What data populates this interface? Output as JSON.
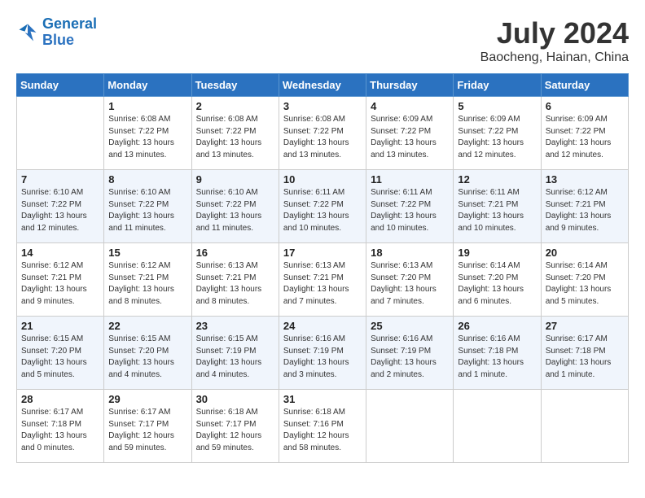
{
  "header": {
    "logo_line1": "General",
    "logo_line2": "Blue",
    "month": "July 2024",
    "location": "Baocheng, Hainan, China"
  },
  "days_of_week": [
    "Sunday",
    "Monday",
    "Tuesday",
    "Wednesday",
    "Thursday",
    "Friday",
    "Saturday"
  ],
  "weeks": [
    [
      {
        "day": "",
        "info": ""
      },
      {
        "day": "1",
        "info": "Sunrise: 6:08 AM\nSunset: 7:22 PM\nDaylight: 13 hours\nand 13 minutes."
      },
      {
        "day": "2",
        "info": "Sunrise: 6:08 AM\nSunset: 7:22 PM\nDaylight: 13 hours\nand 13 minutes."
      },
      {
        "day": "3",
        "info": "Sunrise: 6:08 AM\nSunset: 7:22 PM\nDaylight: 13 hours\nand 13 minutes."
      },
      {
        "day": "4",
        "info": "Sunrise: 6:09 AM\nSunset: 7:22 PM\nDaylight: 13 hours\nand 13 minutes."
      },
      {
        "day": "5",
        "info": "Sunrise: 6:09 AM\nSunset: 7:22 PM\nDaylight: 13 hours\nand 12 minutes."
      },
      {
        "day": "6",
        "info": "Sunrise: 6:09 AM\nSunset: 7:22 PM\nDaylight: 13 hours\nand 12 minutes."
      }
    ],
    [
      {
        "day": "7",
        "info": "Sunrise: 6:10 AM\nSunset: 7:22 PM\nDaylight: 13 hours\nand 12 minutes."
      },
      {
        "day": "8",
        "info": "Sunrise: 6:10 AM\nSunset: 7:22 PM\nDaylight: 13 hours\nand 11 minutes."
      },
      {
        "day": "9",
        "info": "Sunrise: 6:10 AM\nSunset: 7:22 PM\nDaylight: 13 hours\nand 11 minutes."
      },
      {
        "day": "10",
        "info": "Sunrise: 6:11 AM\nSunset: 7:22 PM\nDaylight: 13 hours\nand 10 minutes."
      },
      {
        "day": "11",
        "info": "Sunrise: 6:11 AM\nSunset: 7:22 PM\nDaylight: 13 hours\nand 10 minutes."
      },
      {
        "day": "12",
        "info": "Sunrise: 6:11 AM\nSunset: 7:21 PM\nDaylight: 13 hours\nand 10 minutes."
      },
      {
        "day": "13",
        "info": "Sunrise: 6:12 AM\nSunset: 7:21 PM\nDaylight: 13 hours\nand 9 minutes."
      }
    ],
    [
      {
        "day": "14",
        "info": "Sunrise: 6:12 AM\nSunset: 7:21 PM\nDaylight: 13 hours\nand 9 minutes."
      },
      {
        "day": "15",
        "info": "Sunrise: 6:12 AM\nSunset: 7:21 PM\nDaylight: 13 hours\nand 8 minutes."
      },
      {
        "day": "16",
        "info": "Sunrise: 6:13 AM\nSunset: 7:21 PM\nDaylight: 13 hours\nand 8 minutes."
      },
      {
        "day": "17",
        "info": "Sunrise: 6:13 AM\nSunset: 7:21 PM\nDaylight: 13 hours\nand 7 minutes."
      },
      {
        "day": "18",
        "info": "Sunrise: 6:13 AM\nSunset: 7:20 PM\nDaylight: 13 hours\nand 7 minutes."
      },
      {
        "day": "19",
        "info": "Sunrise: 6:14 AM\nSunset: 7:20 PM\nDaylight: 13 hours\nand 6 minutes."
      },
      {
        "day": "20",
        "info": "Sunrise: 6:14 AM\nSunset: 7:20 PM\nDaylight: 13 hours\nand 5 minutes."
      }
    ],
    [
      {
        "day": "21",
        "info": "Sunrise: 6:15 AM\nSunset: 7:20 PM\nDaylight: 13 hours\nand 5 minutes."
      },
      {
        "day": "22",
        "info": "Sunrise: 6:15 AM\nSunset: 7:20 PM\nDaylight: 13 hours\nand 4 minutes."
      },
      {
        "day": "23",
        "info": "Sunrise: 6:15 AM\nSunset: 7:19 PM\nDaylight: 13 hours\nand 4 minutes."
      },
      {
        "day": "24",
        "info": "Sunrise: 6:16 AM\nSunset: 7:19 PM\nDaylight: 13 hours\nand 3 minutes."
      },
      {
        "day": "25",
        "info": "Sunrise: 6:16 AM\nSunset: 7:19 PM\nDaylight: 13 hours\nand 2 minutes."
      },
      {
        "day": "26",
        "info": "Sunrise: 6:16 AM\nSunset: 7:18 PM\nDaylight: 13 hours\nand 1 minute."
      },
      {
        "day": "27",
        "info": "Sunrise: 6:17 AM\nSunset: 7:18 PM\nDaylight: 13 hours\nand 1 minute."
      }
    ],
    [
      {
        "day": "28",
        "info": "Sunrise: 6:17 AM\nSunset: 7:18 PM\nDaylight: 13 hours\nand 0 minutes."
      },
      {
        "day": "29",
        "info": "Sunrise: 6:17 AM\nSunset: 7:17 PM\nDaylight: 12 hours\nand 59 minutes."
      },
      {
        "day": "30",
        "info": "Sunrise: 6:18 AM\nSunset: 7:17 PM\nDaylight: 12 hours\nand 59 minutes."
      },
      {
        "day": "31",
        "info": "Sunrise: 6:18 AM\nSunset: 7:16 PM\nDaylight: 12 hours\nand 58 minutes."
      },
      {
        "day": "",
        "info": ""
      },
      {
        "day": "",
        "info": ""
      },
      {
        "day": "",
        "info": ""
      }
    ]
  ]
}
